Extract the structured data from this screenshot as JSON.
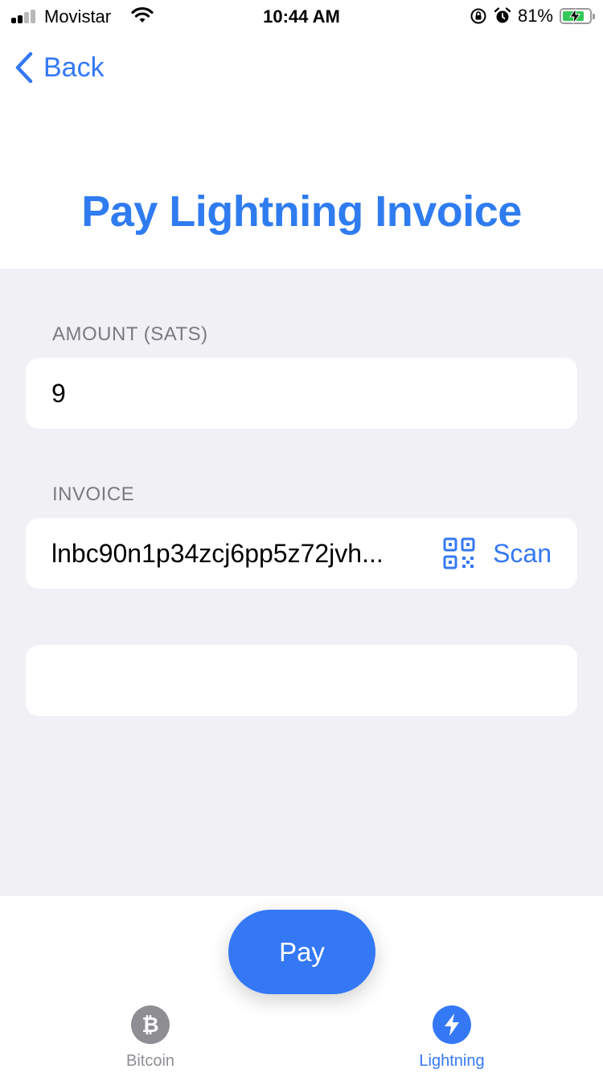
{
  "status_bar": {
    "carrier": "Movistar",
    "time": "10:44 AM",
    "battery": "81%"
  },
  "nav": {
    "back_label": "Back"
  },
  "page": {
    "title": "Pay Lightning Invoice"
  },
  "form": {
    "amount_label": "AMOUNT (SATS)",
    "amount_value": "9",
    "invoice_label": "INVOICE",
    "invoice_value": "lnbc90n1p34zcj6pp5z72jvh...",
    "scan_label": "Scan",
    "memo_value": ""
  },
  "actions": {
    "pay_label": "Pay"
  },
  "tabs": [
    {
      "label": "Bitcoin",
      "icon": "bitcoin-icon",
      "active": false
    },
    {
      "label": "Lightning",
      "icon": "lightning-icon",
      "active": true
    }
  ],
  "colors": {
    "accent": "#3478f6",
    "title": "#2f7cf0",
    "form_bg": "#f0f0f5",
    "inactive": "#8e8e93"
  }
}
